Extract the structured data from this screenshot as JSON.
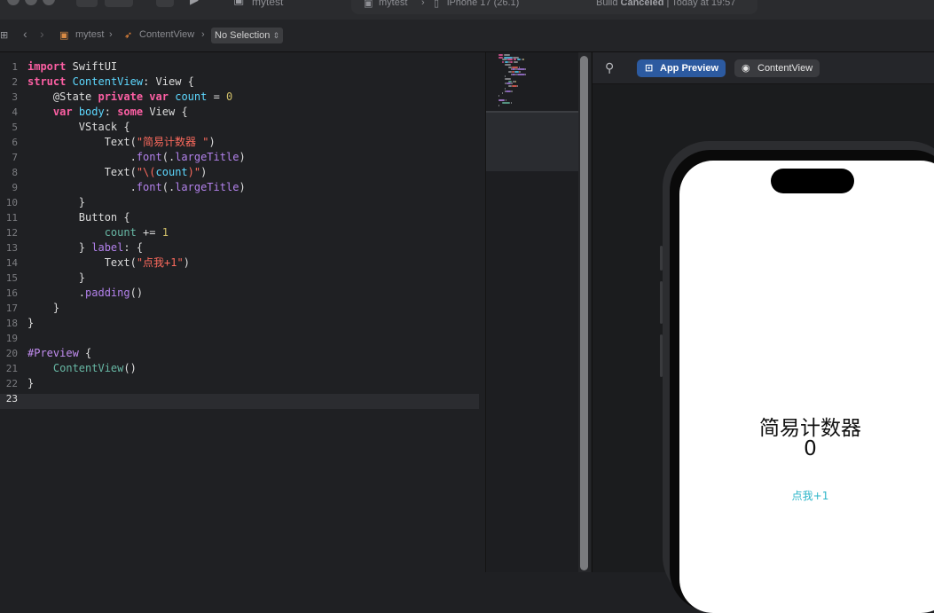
{
  "toolbar": {
    "project_name": "mytest",
    "scheme": "mytest",
    "destination": "iPhone 17 (26.1)",
    "status_prefix": "Build",
    "status_bold": "Canceled",
    "status_time": "| Today at 19:57"
  },
  "jumpbar": {
    "project": "mytest",
    "file": "ContentView",
    "selection": "No Selection"
  },
  "editor": {
    "active_line": 23,
    "line_numbers": [
      "1",
      "2",
      "3",
      "4",
      "5",
      "6",
      "7",
      "8",
      "9",
      "10",
      "11",
      "12",
      "13",
      "14",
      "15",
      "16",
      "17",
      "18",
      "19",
      "20",
      "21",
      "22",
      "23"
    ],
    "lines": [
      [
        {
          "t": "import",
          "c": "kw"
        },
        {
          "t": " SwiftUI",
          "c": "plain"
        }
      ],
      [
        {
          "t": "struct",
          "c": "kw"
        },
        {
          "t": " ",
          "c": "plain"
        },
        {
          "t": "ContentView",
          "c": "ty"
        },
        {
          "t": ": View {",
          "c": "plain"
        }
      ],
      [
        {
          "t": "    @State ",
          "c": "plain"
        },
        {
          "t": "private",
          "c": "kw"
        },
        {
          "t": " ",
          "c": "plain"
        },
        {
          "t": "var",
          "c": "kw"
        },
        {
          "t": " ",
          "c": "plain"
        },
        {
          "t": "count",
          "c": "ty"
        },
        {
          "t": " = ",
          "c": "plain"
        },
        {
          "t": "0",
          "c": "num"
        }
      ],
      [
        {
          "t": "    ",
          "c": "plain"
        },
        {
          "t": "var",
          "c": "kw"
        },
        {
          "t": " ",
          "c": "plain"
        },
        {
          "t": "body",
          "c": "ty"
        },
        {
          "t": ": ",
          "c": "plain"
        },
        {
          "t": "some",
          "c": "kw"
        },
        {
          "t": " View {",
          "c": "plain"
        }
      ],
      [
        {
          "t": "        VStack {",
          "c": "plain"
        }
      ],
      [
        {
          "t": "            Text(",
          "c": "plain"
        },
        {
          "t": "\"简易计数器 \"",
          "c": "str"
        },
        {
          "t": ")",
          "c": "plain"
        }
      ],
      [
        {
          "t": "                .",
          "c": "plain"
        },
        {
          "t": "font",
          "c": "prop"
        },
        {
          "t": "(.",
          "c": "plain"
        },
        {
          "t": "largeTitle",
          "c": "prop"
        },
        {
          "t": ")",
          "c": "plain"
        }
      ],
      [
        {
          "t": "            Text(",
          "c": "plain"
        },
        {
          "t": "\"\\(",
          "c": "str"
        },
        {
          "t": "count",
          "c": "ty"
        },
        {
          "t": ")\"",
          "c": "str"
        },
        {
          "t": ")",
          "c": "plain"
        }
      ],
      [
        {
          "t": "                .",
          "c": "plain"
        },
        {
          "t": "font",
          "c": "prop"
        },
        {
          "t": "(.",
          "c": "plain"
        },
        {
          "t": "largeTitle",
          "c": "prop"
        },
        {
          "t": ")",
          "c": "plain"
        }
      ],
      [
        {
          "t": "        }",
          "c": "plain"
        }
      ],
      [
        {
          "t": "        Button {",
          "c": "plain"
        }
      ],
      [
        {
          "t": "            ",
          "c": "plain"
        },
        {
          "t": "count",
          "c": "fn"
        },
        {
          "t": " += ",
          "c": "plain"
        },
        {
          "t": "1",
          "c": "num"
        }
      ],
      [
        {
          "t": "        } ",
          "c": "plain"
        },
        {
          "t": "label",
          "c": "prop"
        },
        {
          "t": ": {",
          "c": "plain"
        }
      ],
      [
        {
          "t": "            Text(",
          "c": "plain"
        },
        {
          "t": "\"点我+1\"",
          "c": "str"
        },
        {
          "t": ")",
          "c": "plain"
        }
      ],
      [
        {
          "t": "        }",
          "c": "plain"
        }
      ],
      [
        {
          "t": "        .",
          "c": "plain"
        },
        {
          "t": "padding",
          "c": "prop"
        },
        {
          "t": "()",
          "c": "plain"
        }
      ],
      [
        {
          "t": "    }",
          "c": "plain"
        }
      ],
      [
        {
          "t": "}",
          "c": "plain"
        }
      ],
      [],
      [
        {
          "t": "#Preview",
          "c": "attr"
        },
        {
          "t": " {",
          "c": "plain"
        }
      ],
      [
        {
          "t": "    ",
          "c": "plain"
        },
        {
          "t": "ContentView",
          "c": "fn"
        },
        {
          "t": "()",
          "c": "plain"
        }
      ],
      [
        {
          "t": "}",
          "c": "plain"
        }
      ],
      []
    ]
  },
  "canvas": {
    "app_preview_label": "App Preview",
    "content_view_label": "ContentView"
  },
  "preview_app": {
    "title": "简易计数器",
    "count": "0",
    "button_label": "点我+1"
  },
  "colors": {
    "keyword": "#fc5fa3",
    "type": "#5dd8ff",
    "string": "#fc6a5d",
    "number": "#d0bf69",
    "accent": "#2c5aa0",
    "app_button": "#2bb5c8"
  }
}
